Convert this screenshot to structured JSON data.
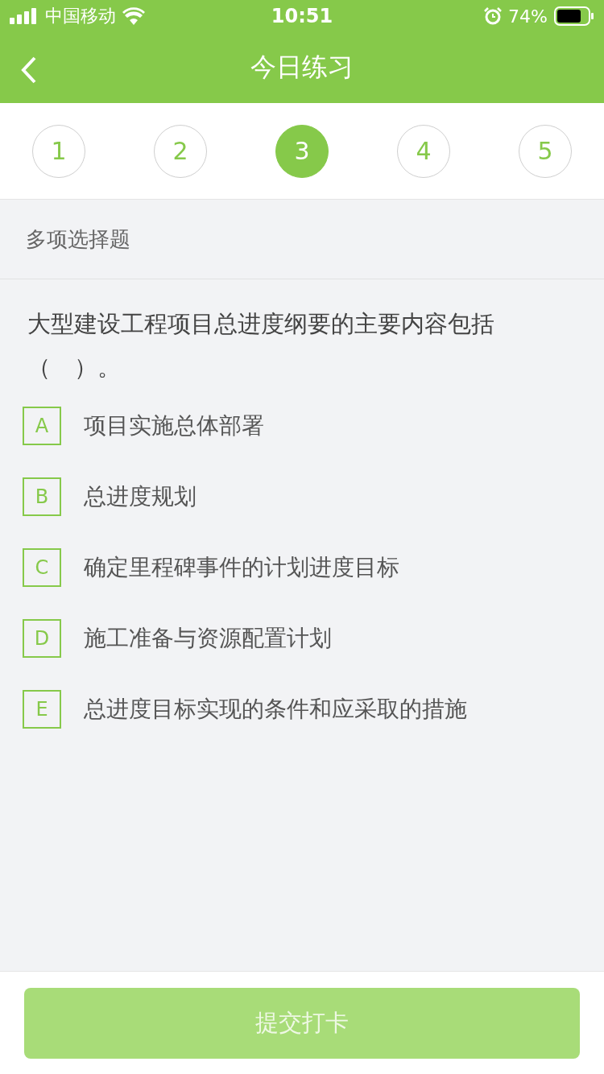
{
  "status_bar": {
    "carrier": "中国移动",
    "time": "10:51",
    "battery": "74%"
  },
  "nav": {
    "title": "今日练习"
  },
  "steps": [
    {
      "label": "1",
      "selected": false
    },
    {
      "label": "2",
      "selected": false
    },
    {
      "label": "3",
      "selected": true
    },
    {
      "label": "4",
      "selected": false
    },
    {
      "label": "5",
      "selected": false
    }
  ],
  "question_type": "多项选择题",
  "question": "大型建设工程项目总进度纲要的主要内容包括（　）。",
  "options": [
    {
      "letter": "A",
      "text": "项目实施总体部署",
      "selected": false
    },
    {
      "letter": "B",
      "text": "总进度规划",
      "selected": false
    },
    {
      "letter": "C",
      "text": "确定里程碑事件的计划进度目标",
      "selected": false
    },
    {
      "letter": "D",
      "text": "施工准备与资源配置计划",
      "selected": false
    },
    {
      "letter": "E",
      "text": "总进度目标实现的条件和应采取的措施",
      "selected": false
    }
  ],
  "submit": {
    "label": "提交打卡",
    "disabled": true
  }
}
